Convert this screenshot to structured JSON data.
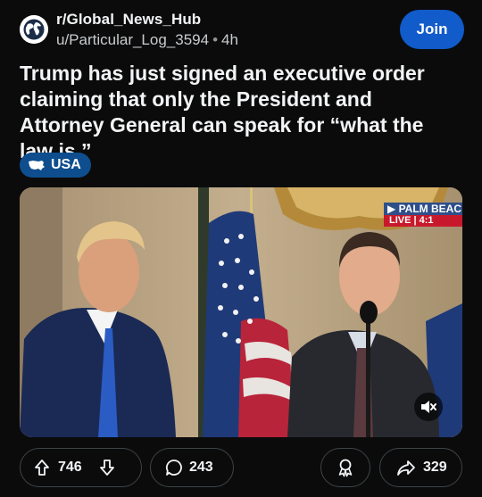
{
  "post": {
    "subreddit": "r/Global_News_Hub",
    "author": "u/Particular_Log_3594",
    "separator": "•",
    "age": "4h",
    "join_label": "Join",
    "title": "Trump has just signed an executive order claiming that only the President and Attorney General can speak for “what the law is.”",
    "flair": {
      "label": "USA",
      "icon": "us-map-icon"
    }
  },
  "media": {
    "broadcast_location": "PALM BEAC",
    "live_label": "LIVE",
    "time_text": "4:1",
    "mute_icon": "speaker-muted-icon"
  },
  "actions": {
    "upvotes": "746",
    "comments": "243",
    "shares": "329"
  },
  "colors": {
    "background": "#0b0b0c",
    "join_button": "#115bca",
    "flair": "#0e4e8e",
    "live_red": "#c8192c"
  }
}
